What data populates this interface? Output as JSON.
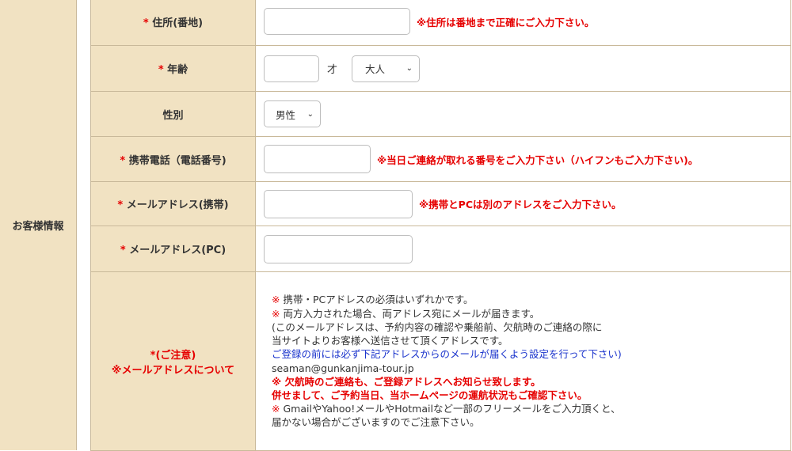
{
  "section_label": "お客様情報",
  "rows": [
    {
      "required": "*",
      "label": "住所(番地)",
      "hint": "※住所は番地まで正確にご入力下さい。"
    },
    {
      "required": "*",
      "label": "年齢",
      "unit": "才",
      "age_type": "大人"
    },
    {
      "required": "",
      "label": "性別",
      "gender": "男性"
    },
    {
      "required": "*",
      "label": "携帯電話（電話番号)",
      "hint": "※当日ご連絡が取れる番号をご入力下さい（ハイフンもご入力下さい)。"
    },
    {
      "required": "*",
      "label": "メールアドレス(携帯)",
      "hint": "※携帯とPCは別のアドレスをご入力下さい。"
    },
    {
      "required": "*",
      "label": "メールアドレス(PC)"
    }
  ],
  "notice": {
    "label_line1": "*(ご注意)",
    "label_line2": "※メールアドレスについて",
    "lines": [
      {
        "mark": "※",
        "text": " 携帯・PCアドレスの必須はいずれかです。"
      },
      {
        "mark": "※",
        "text": " 両方入力された場合、両アドレス宛にメールが届きます。"
      },
      {
        "text": "(このメールアドレスは、予約内容の確認や乗船前、欠航時のご連絡の際に"
      },
      {
        "text": "当サイトよりお客様へ送信させて頂くアドレスです。"
      },
      {
        "text": "ご登録の前には必ず下記アドレスからのメールが届くよう設定を行って下さい)"
      },
      {
        "text": "seaman@gunkanjima-tour.jp"
      },
      {
        "text": "※ 欠航時のご連絡も、ご登録アドレスへお知らせ致します。"
      },
      {
        "text": "併せまして、ご予約当日、当ホームページの運航状況もご確認下さい。"
      },
      {
        "mark": "※",
        "text": " GmailやYahoo!メールやHotmailなど一部のフリーメールをご入力頂くと、"
      },
      {
        "text": "届かない場合がございますのでご注意下さい。"
      }
    ]
  },
  "colors": {
    "label_bg": "#f1e2c2",
    "border": "#c9b99a",
    "required": "#e60000",
    "link_blue": "#1a33cc"
  }
}
